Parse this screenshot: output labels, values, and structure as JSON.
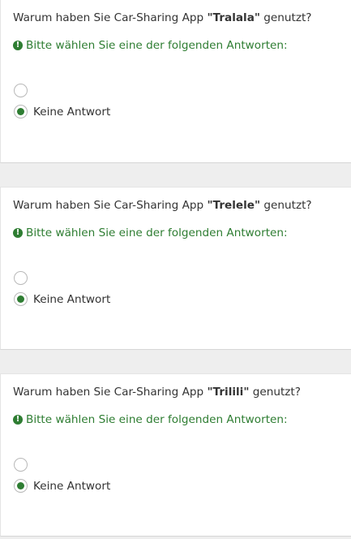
{
  "tip": "Bitte wählen Sie eine der folgenden Antworten:",
  "questions": [
    {
      "prefix": "Warum haben Sie Car-Sharing App ",
      "app": "\"Tralala\"",
      "suffix": " genutzt?",
      "options": [
        {
          "label": "",
          "checked": false
        },
        {
          "label": "Keine Antwort",
          "checked": true
        }
      ]
    },
    {
      "prefix": "Warum haben Sie Car-Sharing App ",
      "app": "\"Trelele\"",
      "suffix": " genutzt?",
      "options": [
        {
          "label": "",
          "checked": false
        },
        {
          "label": "Keine Antwort",
          "checked": true
        }
      ]
    },
    {
      "prefix": "Warum haben Sie Car-Sharing App ",
      "app": "\"Trilili\"",
      "suffix": " genutzt?",
      "options": [
        {
          "label": "",
          "checked": false
        },
        {
          "label": "Keine Antwort",
          "checked": true
        }
      ]
    }
  ],
  "icons": {
    "tip": "exclamation-circle-icon"
  },
  "colors": {
    "accent": "#2e7d32",
    "text": "#333333"
  }
}
